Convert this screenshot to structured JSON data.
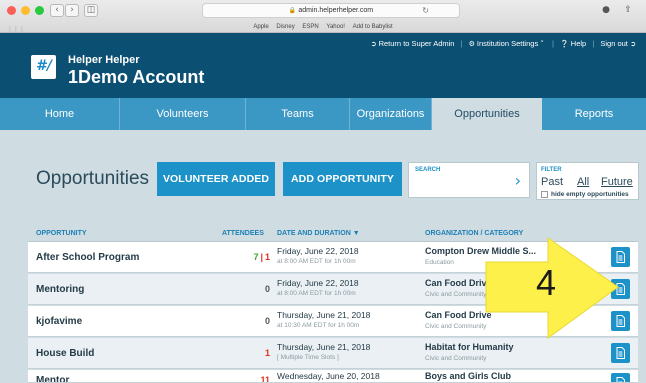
{
  "browser": {
    "url": "admin.helperhelper.com",
    "bookmarks": [
      "Apple",
      "Disney",
      "ESPN",
      "Yahoo!",
      "Add to Babylist"
    ]
  },
  "header": {
    "brand": "Helper Helper",
    "account": "1Demo Account",
    "logo_text": "HH",
    "links": {
      "super_admin": "Return to Super Admin",
      "institution_settings": "Institution Settings",
      "help": "Help",
      "sign_out": "Sign out"
    }
  },
  "nav": {
    "items": [
      "Home",
      "Volunteers",
      "Teams",
      "Organizations",
      "Opportunities",
      "Reports"
    ],
    "active": "Opportunities"
  },
  "toolbar": {
    "title": "Opportunities",
    "volunteer_added": "VOLUNTEER ADDED",
    "add_opportunity": "ADD OPPORTUNITY",
    "search_label": "SEARCH",
    "search_value": ""
  },
  "filter": {
    "label": "FILTER",
    "options": [
      "Past",
      "All",
      "Future"
    ],
    "hide_empty": "hide empty opportunities"
  },
  "table": {
    "columns": {
      "opportunity": "OPPORTUNITY",
      "attendees": "ATTENDEES",
      "date": "DATE AND DURATION ▼",
      "org": "ORGANIZATION / CATEGORY"
    },
    "rows": [
      {
        "name": "After School Program",
        "att_primary": "7",
        "att_secondary": "1",
        "date": "Friday, June 22, 2018",
        "time": "at 8:00 AM EDT for 1h 00m",
        "org": "Compton Drew Middle S...",
        "category": "Education"
      },
      {
        "name": "Mentoring",
        "att_primary": "0",
        "att_secondary": "",
        "date": "Friday, June 22, 2018",
        "time": "at 8:00 AM EDT for 1h 00m",
        "org": "Can Food Drive",
        "category": "Civic and Community"
      },
      {
        "name": "kjofavime",
        "att_primary": "0",
        "att_secondary": "",
        "date": "Thursday, June 21, 2018",
        "time": "at 10:30 AM EDT for 1h 00m",
        "org": "Can Food Drive",
        "category": "Civic and Community"
      },
      {
        "name": "House Build",
        "att_primary": "1",
        "att_secondary": "",
        "date": "Thursday, June 21, 2018",
        "time": "[ Multiple Time Slots ]",
        "org": "Habitat for Humanity",
        "category": "Civic and Community"
      },
      {
        "name": "Mentor",
        "att_primary": "11",
        "att_secondary": "",
        "date": "Wednesday, June 20, 2018",
        "time": "",
        "org": "Boys and Girls Club",
        "category": ""
      }
    ]
  },
  "annotation": {
    "number": "4",
    "color": "#fdf04a"
  },
  "colors": {
    "header_bg": "#0b4f72",
    "nav_bg": "#3b97c4",
    "accent": "#1c92c8",
    "page_bg": "#cfdde3"
  }
}
